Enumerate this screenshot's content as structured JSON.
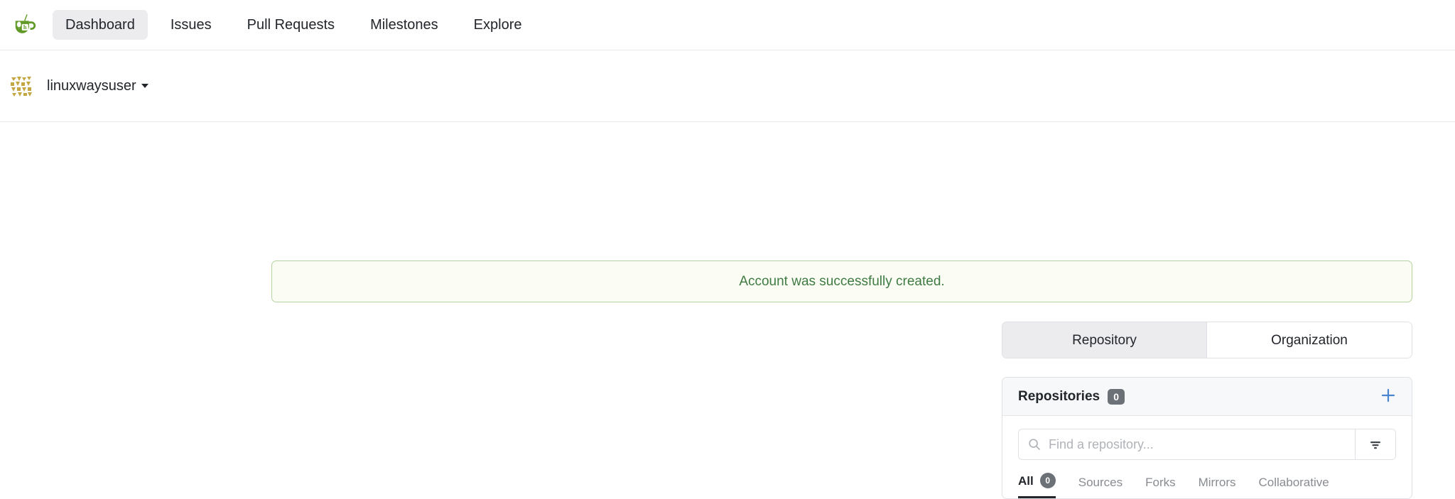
{
  "navbar": {
    "logo_icon": "gitea-teacup-logo-icon",
    "items": [
      {
        "label": "Dashboard",
        "active": true
      },
      {
        "label": "Issues",
        "active": false
      },
      {
        "label": "Pull Requests",
        "active": false
      },
      {
        "label": "Milestones",
        "active": false
      },
      {
        "label": "Explore",
        "active": false
      }
    ]
  },
  "userbar": {
    "avatar_icon": "identicon-avatar",
    "username": "linuxwaysuser",
    "caret_icon": "caret-down-icon"
  },
  "flash": {
    "message": "Account was successfully created.",
    "type": "success",
    "text_color": "#3f7a42",
    "bg_color": "#fbfdf4",
    "border_color": "#b5d3a0"
  },
  "context_switcher": {
    "tabs": [
      {
        "label": "Repository",
        "active": true
      },
      {
        "label": "Organization",
        "active": false
      }
    ]
  },
  "repositories_panel": {
    "title": "Repositories",
    "count": "0",
    "add_icon": "plus-icon",
    "add_color": "#4a86cf",
    "search": {
      "icon": "search-icon",
      "placeholder": "Find a repository...",
      "value": ""
    },
    "filter_button": {
      "icon": "filter-icon"
    },
    "tabs": [
      {
        "label": "All",
        "count": "0",
        "active": true
      },
      {
        "label": "Sources",
        "count": null,
        "active": false
      },
      {
        "label": "Forks",
        "count": null,
        "active": false
      },
      {
        "label": "Mirrors",
        "count": null,
        "active": false
      },
      {
        "label": "Collaborative",
        "count": null,
        "active": false
      }
    ]
  }
}
